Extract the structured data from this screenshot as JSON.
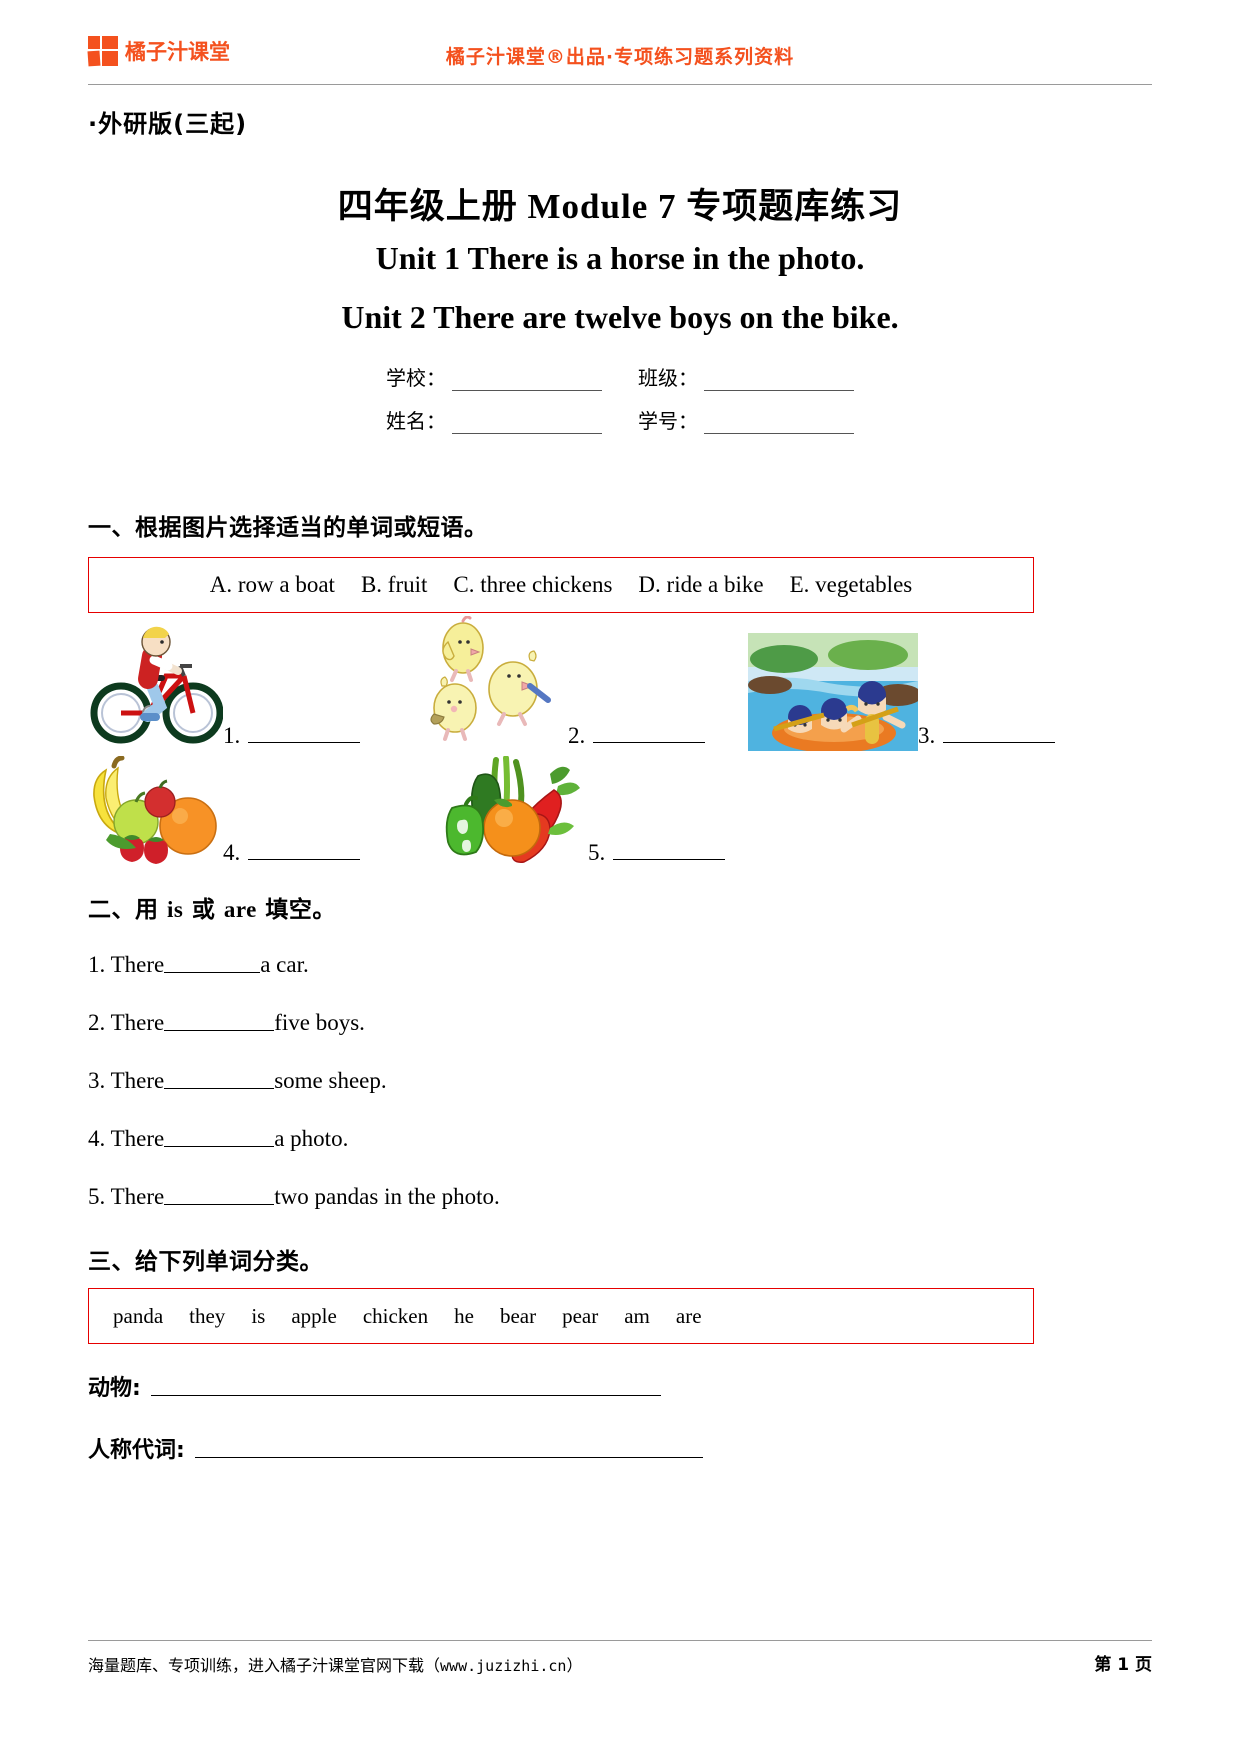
{
  "header": {
    "logo_text": "橘子汁课堂",
    "logo_icon": "four-square-grid-icon",
    "tagline": "橘子汁课堂®出品·专项练习题系列资料",
    "brand_color": "#F4511E"
  },
  "doc": {
    "edition": "·外研版(三起)",
    "title_main": "四年级上册 Module 7 专项题库练习",
    "title_unit1": "Unit 1 There is a horse in the photo.",
    "title_unit2": "Unit 2 There are twelve boys on the bike.",
    "info_fields": [
      {
        "label": "学校：",
        "value": ""
      },
      {
        "label": "班级：",
        "value": ""
      },
      {
        "label": "姓名：",
        "value": ""
      },
      {
        "label": "学号：",
        "value": ""
      }
    ]
  },
  "section1": {
    "heading": "一、根据图片选择适当的单词或短语。",
    "box_border_color": "#e60000",
    "options": [
      "A. row a boat",
      "B. fruit",
      "C. three chickens",
      "D. ride a bike",
      "E. vegetables"
    ],
    "items": [
      {
        "number": "1.",
        "answer": "",
        "picture": "boy-riding-bike-picture"
      },
      {
        "number": "2.",
        "answer": "",
        "picture": "three-chickens-picture"
      },
      {
        "number": "3.",
        "answer": "",
        "picture": "kids-rafting-boat-picture"
      },
      {
        "number": "4.",
        "answer": "",
        "picture": "fruit-basket-picture"
      },
      {
        "number": "5.",
        "answer": "",
        "picture": "vegetables-picture"
      }
    ]
  },
  "section2": {
    "heading_prefix": "二、用 ",
    "heading_word1": "is",
    "heading_middle": " 或 ",
    "heading_word2": "are",
    "heading_suffix": " 填空。",
    "questions": [
      {
        "prefix": "1. There",
        "answer": "",
        "suffix": " a car."
      },
      {
        "prefix": "2. There ",
        "answer": "",
        "suffix": "five boys."
      },
      {
        "prefix": "3. There ",
        "answer": "",
        "suffix": "some sheep."
      },
      {
        "prefix": "4. There ",
        "answer": "",
        "suffix": "a photo."
      },
      {
        "prefix": "5. There ",
        "answer": "",
        "suffix": "two pandas in the photo."
      }
    ]
  },
  "section3": {
    "heading": "三、给下列单词分类。",
    "box_border_color": "#e60000",
    "words": [
      "panda",
      "they",
      "is",
      "apple",
      "chicken",
      "he",
      "bear",
      "pear",
      "am",
      "are"
    ],
    "categories": [
      {
        "label": "动物:",
        "answer": ""
      },
      {
        "label": "人称代词:",
        "answer": ""
      }
    ]
  },
  "footer": {
    "note": "海量题库、专项训练，进入橘子汁课堂官网下载（",
    "site": "www.juzizhi.cn",
    "note_end": "）",
    "page": "第 1 页"
  }
}
